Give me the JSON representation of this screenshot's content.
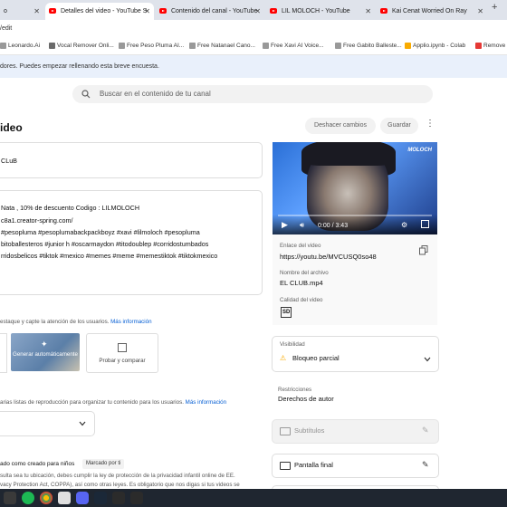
{
  "browser": {
    "tabs": [
      {
        "label": "o",
        "active": false
      },
      {
        "label": "Detalles del video - YouTube S",
        "active": true
      },
      {
        "label": "Contenido del canal - YouTube",
        "active": false
      },
      {
        "label": "LIL MOLOCH - YouTube",
        "active": false
      },
      {
        "label": "Kai Cenat Worried On Ray",
        "active": false
      }
    ],
    "address_fragment": "/edit",
    "bookmarks": [
      {
        "label": "Leonardo.Ai"
      },
      {
        "label": "Vocal Remover Onli..."
      },
      {
        "label": "Free Peso Pluma AI..."
      },
      {
        "label": "Free Natanael Cano..."
      },
      {
        "label": "Free Xavi AI Voice..."
      },
      {
        "label": "Free Gabito Balleste..."
      },
      {
        "label": "Applio.ipynb - Colab"
      },
      {
        "label": "Remove"
      }
    ]
  },
  "banner": {
    "text": "dores. Puedes empezar rellenando esta breve encuesta."
  },
  "search": {
    "placeholder": "Buscar en el contenido de tu canal"
  },
  "header": {
    "title": "ideo",
    "undo_label": "Deshacer cambios",
    "save_label": "Guardar"
  },
  "form": {
    "title_value": "CLuB",
    "description_lines": [
      "Nata , 10% de descuento Codigo : LILMOLOCH",
      "c8a1.creator-spring.com/",
      "#pesopluma  #pesoplumabackpackboyz  #xavi  #lilmoloch #pesopluma",
      "bitoballesteros #junior h #oscarmaydon #titodoublep #corridostumbados",
      "rridosbelicos #tiktok #mexico #memes #meme #memestiktok #tiktokmexico"
    ],
    "thumbnail_hint": "estaque y capte la atención de los usuarios.",
    "thumbnail_link": "Más información",
    "auto_generate_label": "Generar automáticamente",
    "test_compare_label": "Probar y comparar",
    "playlist_hint": "arias listas de reproducción para organizar tu contenido para los usuarios.",
    "playlist_link": "Más información",
    "audience_label": "ado como creado para niños",
    "audience_badge": "Marcado por ti",
    "audience_text_1": "sulta sea tu ubicación, debes cumplir la ley de protección de la privacidad infantil online de EE.",
    "audience_text_2": "vacy Protection Act, COPPA), así como otras leyes. Es obligatorio que nos digas si tus videos se"
  },
  "player": {
    "time": "0:00 / 3:43",
    "watermark": "MOLOCH"
  },
  "details": {
    "link_label": "Enlace del video",
    "link_value": "https://youtu.be/MVCUSQ0so48",
    "filename_label": "Nombre del archivo",
    "filename_value": "EL CLUB.mp4",
    "quality_label": "Calidad del video",
    "quality_badge": "SD"
  },
  "sidebar": {
    "visibility_label": "Visibilidad",
    "visibility_value": "Bloqueo parcial",
    "restrictions_label": "Restricciones",
    "restrictions_value": "Derechos de autor",
    "subtitles_label": "Subtítulos",
    "endscreen_label": "Pantalla final"
  }
}
